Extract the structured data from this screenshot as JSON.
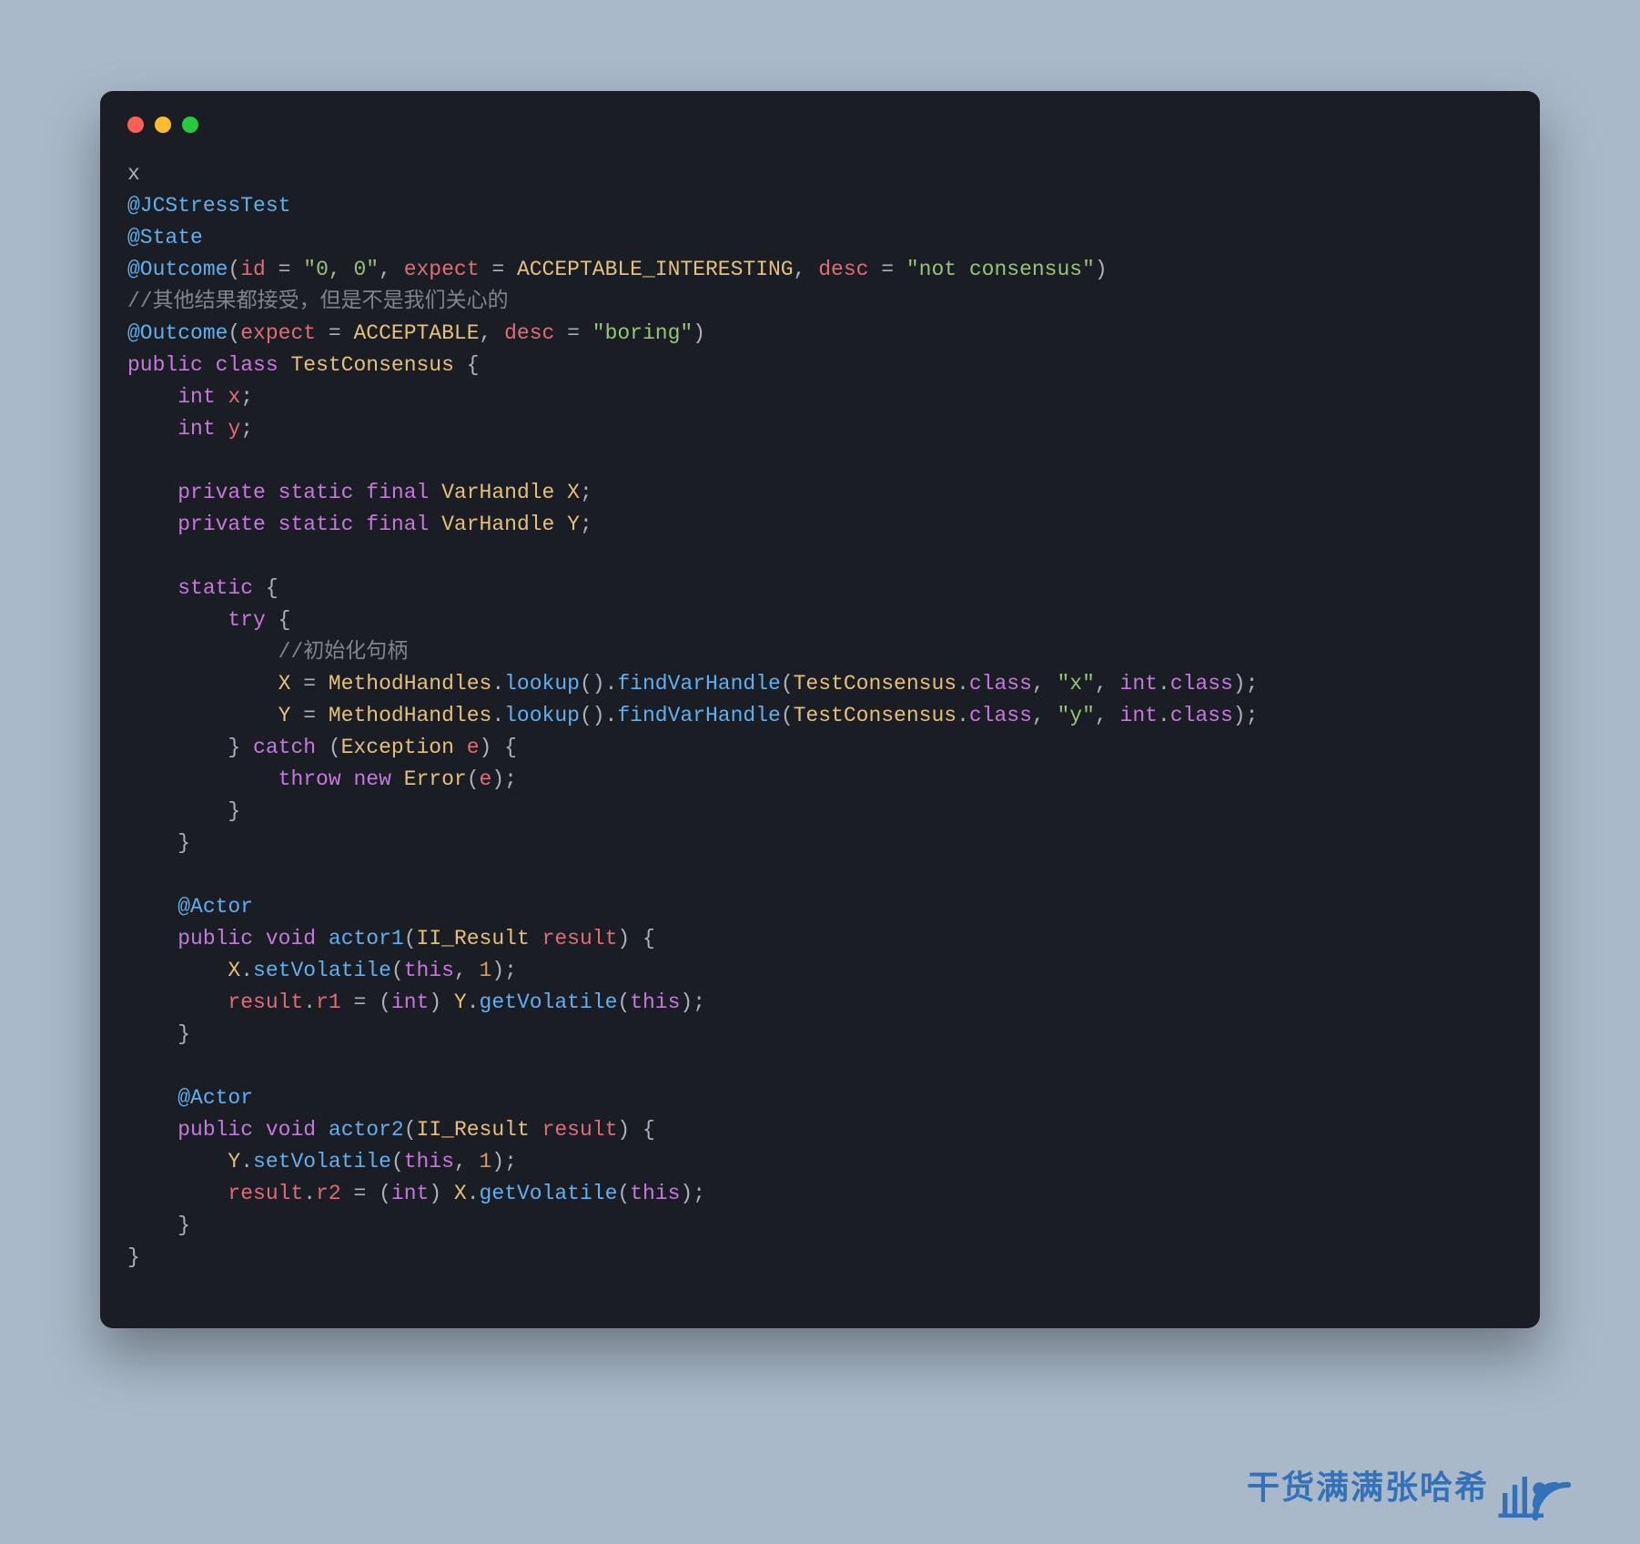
{
  "code": {
    "line1_text": "x",
    "ann_jcstress": "@JCStressTest",
    "ann_state": "@State",
    "ann_outcome1_name": "@Outcome",
    "ann_outcome1_id_key": "id",
    "ann_outcome1_id_val": "\"0, 0\"",
    "ann_outcome1_expect_key": "expect",
    "ann_outcome1_expect_val": "ACCEPTABLE_INTERESTING",
    "ann_outcome1_desc_key": "desc",
    "ann_outcome1_desc_val": "\"not consensus\"",
    "comment_outcome": "//其他结果都接受，但是不是我们关心的",
    "ann_outcome2_name": "@Outcome",
    "ann_outcome2_expect_key": "expect",
    "ann_outcome2_expect_val": "ACCEPTABLE",
    "ann_outcome2_desc_key": "desc",
    "ann_outcome2_desc_val": "\"boring\"",
    "kw_public": "public",
    "kw_class": "class",
    "class_name": "TestConsensus",
    "kw_int": "int",
    "field_x": "x",
    "field_y": "y",
    "kw_private": "private",
    "kw_static": "static",
    "kw_final": "final",
    "type_varhandle": "VarHandle",
    "const_X": "X",
    "const_Y": "Y",
    "kw_try": "try",
    "comment_init": "//初始化句柄",
    "cls_methodhandles": "MethodHandles",
    "m_lookup": "lookup",
    "m_findvar": "findVarHandle",
    "ref_testconsensus": "TestConsensus",
    "kw_classref": "class",
    "str_x": "\"x\"",
    "str_y": "\"y\"",
    "kw_intref": "int",
    "kw_catch": "catch",
    "type_exception": "Exception",
    "var_e": "e",
    "kw_throw": "throw",
    "kw_new": "new",
    "type_error": "Error",
    "ann_actor": "@Actor",
    "kw_void": "void",
    "m_actor1": "actor1",
    "m_actor2": "actor2",
    "type_iiresult": "II_Result",
    "param_result": "result",
    "m_setvol": "setVolatile",
    "kw_this": "this",
    "num_1": "1",
    "field_r1": "r1",
    "field_r2": "r2",
    "cast_int": "int",
    "m_getvol": "getVolatile"
  },
  "watermark": {
    "text": "干货满满张哈希"
  }
}
